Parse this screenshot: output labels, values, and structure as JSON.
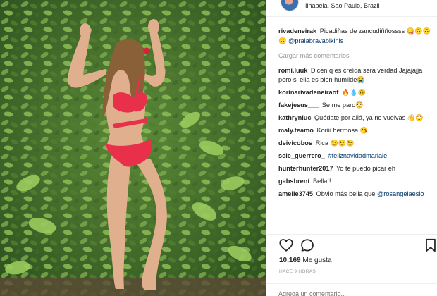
{
  "post": {
    "location": "Ilhabela, Sao Paulo, Brazil",
    "likes_count": "10,169",
    "likes_label": "Me gusta",
    "time_ago": "HACE 9 HORAS",
    "add_comment_placeholder": "Agrega un comentario..."
  },
  "caption": {
    "user": "rivadeneirak",
    "text": "Picadiñas de zancudiññossss 😋🙃🙃🙃",
    "link": "@praiabravabikinis"
  },
  "load_more": "Cargar más comentarios",
  "comments": [
    {
      "user": "romi.luuk",
      "text": "Dicen q es creída sera verdad Jajajajja pero si ella es bien humilde😭"
    },
    {
      "user": "korinarivadeneiraof",
      "text": "🔥💧🙃"
    },
    {
      "user": "fakejesus___",
      "text": "Se me paro😳"
    },
    {
      "user": "kathrynluc",
      "text": "Quédate por allá, ya no vuelvas 👋🙄"
    },
    {
      "user": "maly.teamo",
      "text": "Koriii hermosa 😘"
    },
    {
      "user": "deivicobos",
      "text": "Rica 😉😉😉"
    },
    {
      "user": "sele_guerrero_",
      "text": "",
      "link": "#feliznavidadmariale"
    },
    {
      "user": "hunterhunter2017",
      "text": "Yo te puedo picar eh"
    },
    {
      "user": "gabsbrent",
      "text": "Bella!!"
    },
    {
      "user": "amelie3745",
      "text": "Obvio más bella que",
      "link": "@rosangelaeslo"
    }
  ],
  "icons": {
    "like": "heart-icon",
    "comment": "comment-bubble-icon",
    "save": "bookmark-icon"
  },
  "colors": {
    "text": "#262626",
    "link": "#003569",
    "muted": "#999999",
    "border": "#efefef",
    "bikini": "#e8304a"
  }
}
